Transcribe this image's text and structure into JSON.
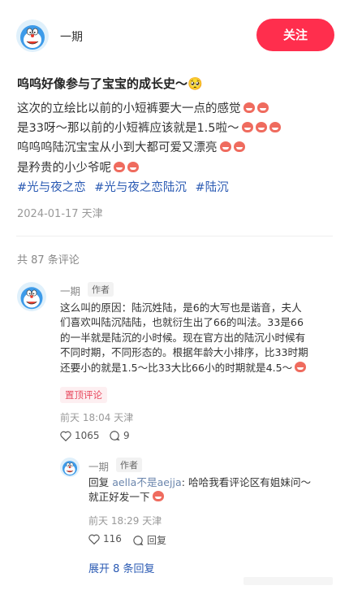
{
  "author": {
    "name": "一期",
    "follow_label": "关注",
    "avatar_icon": "doraemon-avatar-icon"
  },
  "post": {
    "title": "呜呜好像参与了宝宝的成长史～🥺",
    "lines": [
      "这次的立绘比以前的小短裤要大一点的感觉",
      "是33呀～那以前的小短裤应该就是1.5啦～",
      "呜呜呜陆沉宝宝从小到大都可爱又漂亮",
      "是矜贵的小少爷呢"
    ],
    "tags": [
      "#光与夜之恋",
      "#光与夜之恋陆沉",
      "#陆沉"
    ],
    "date": "2024-01-17 天津"
  },
  "comments_summary": {
    "count_label": "共 87 条评论"
  },
  "comment1": {
    "author": "一期",
    "badge": "作者",
    "lines": [
      "这么叫的原因：陆沉姓陆，是6的大写也是谐音，夫人",
      "们喜欢叫陆沉陆陆，也就衍生出了66的叫法。33是66",
      "的一半就是陆沉的小时候。现在官方出的陆沉小时候有",
      "不同时期，不同形态的。根据年龄大小排序，比33时期",
      "还要小的就是1.5～比33大比66小的时期就是4.5～"
    ],
    "pinned_label": "置顶评论",
    "meta": "前天 18:04 天津",
    "likes": "1065",
    "replies": "9"
  },
  "comment2": {
    "author": "一期",
    "badge": "作者",
    "reply_prefix": "回复 ",
    "reply_target": "aella不是aejja",
    "line1_rest": ": 哈哈我看评论区有姐妹问～",
    "line2": "就正好发一下",
    "meta": "前天 18:29 天津",
    "likes": "116",
    "reply_label": "回复"
  },
  "expand_label": "展开 8 条回复",
  "colors": {
    "accent": "#ff2e4d",
    "link": "#2a5ab3",
    "muted": "#999999"
  }
}
